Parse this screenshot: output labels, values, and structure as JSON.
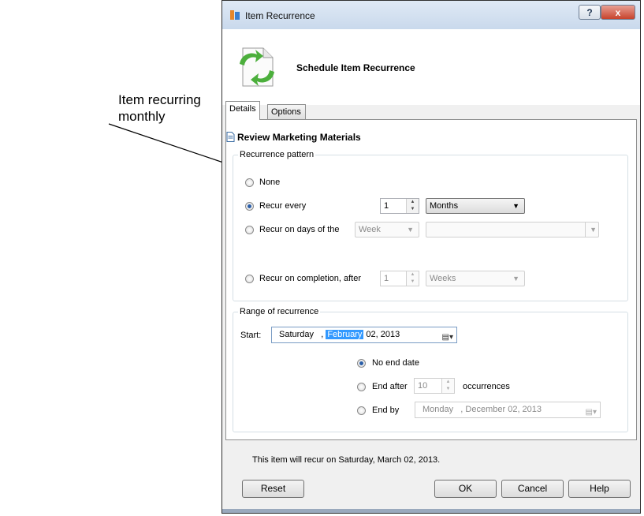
{
  "annotation": {
    "text": "Item recurring monthly"
  },
  "window": {
    "title": "Item Recurrence",
    "help_label": "?",
    "close_label": "x",
    "header_title": "Schedule Item Recurrence"
  },
  "tabs": [
    {
      "label": "Details",
      "active": true
    },
    {
      "label": "Options",
      "active": false
    }
  ],
  "item_title": "Review Marketing Materials",
  "recurrence_pattern": {
    "legend": "Recurrence pattern",
    "none_label": "None",
    "recur_every_label": "Recur every",
    "recur_every_value": "1",
    "recur_every_unit": "Months",
    "days_of_label": "Recur on days of the",
    "days_of_period": "Week",
    "days_of_selection": "",
    "completion_label": "Recur on completion, after",
    "completion_value": "1",
    "completion_unit": "Weeks",
    "selected": "recur_every"
  },
  "range": {
    "legend": "Range of recurrence",
    "start_label": "Start:",
    "start_day": "Saturday",
    "start_sep": ",",
    "start_month": "February",
    "start_rest": "02, 2013",
    "no_end_label": "No end date",
    "end_after_label": "End after",
    "end_after_value": "10",
    "occurrences_label": "occurrences",
    "end_by_label": "End by",
    "end_by_date": "Monday   , December 02, 2013",
    "selected": "no_end"
  },
  "summary": "This item will recur on Saturday, March 02, 2013.",
  "buttons": {
    "reset": "Reset",
    "ok": "OK",
    "cancel": "Cancel",
    "help": "Help"
  },
  "colors": {
    "selection": "#3399ff",
    "radio_dot": "#2a5ea8",
    "close": "#c7432c"
  }
}
